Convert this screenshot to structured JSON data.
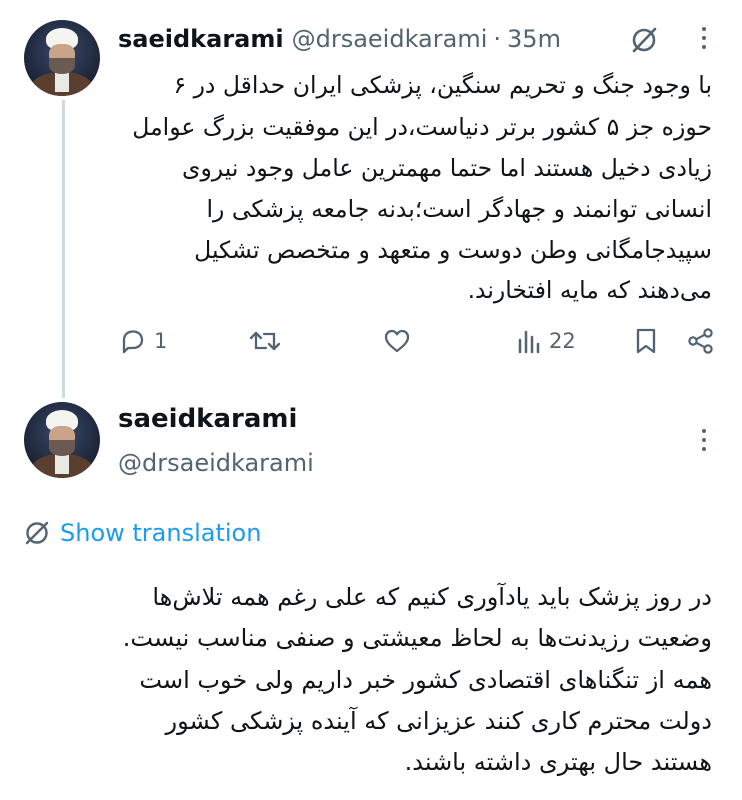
{
  "tweet1": {
    "name": "saeidkarami",
    "handle": "@drsaeidkarami",
    "separator": "·",
    "time": "35m",
    "lines": [
      "با وجود جنگ و تحریم سنگین، پزشکی ایران حداقل در ۶",
      "حوزه جز ۵ کشور برتر دنیاست،در این موفقیت بزرگ عوامل",
      "زیادی دخیل هستند اما حتما مهمترین عامل وجود نیروی",
      "انسانی توانمند و جهادگر است؛بدنه جامعه پزشکی را",
      "سپیدجامگانی وطن دوست و متعهد و متخصص تشکیل",
      "می‌دهند که مایه افتخارند."
    ],
    "actions": {
      "reply_count": "1",
      "retweet_count": "",
      "like_count": "",
      "views_count": "22"
    }
  },
  "tweet2": {
    "name": "saeidkarami",
    "handle": "@drsaeidkarami",
    "translation_label": "Show translation",
    "lines": [
      "در روز پزشک باید یادآوری کنیم که علی رغم همه تلاش‌ها",
      "وضعیت رزیدنت‌ها به لحاظ معیشتی و صنفی مناسب نیست.",
      "همه از تنگناهای اقتصادی کشور خبر داریم ولی خوب است",
      "دولت محترم کاری کنند عزیزانی که آینده پزشکی کشور",
      "هستند حال بهتری داشته باشند."
    ]
  },
  "colors": {
    "text": "#0f1419",
    "secondary": "#536471",
    "link": "#1d9bf0",
    "thread_line": "#cfd9de"
  },
  "icons": [
    "avatar",
    "grok-icon",
    "more-icon",
    "reply-icon",
    "retweet-icon",
    "like-icon",
    "views-icon",
    "bookmark-icon",
    "share-icon",
    "translate-icon"
  ]
}
